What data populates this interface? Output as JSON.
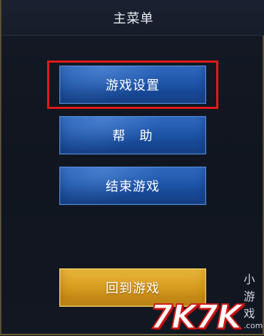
{
  "header": {
    "title": "主菜单"
  },
  "menu": {
    "items": [
      {
        "label": "游戏设置"
      },
      {
        "label": "帮　助"
      },
      {
        "label": "结束游戏"
      }
    ],
    "return_label": "回到游戏"
  },
  "watermark": {
    "logo": "7K7K",
    "subtitle": "小游戏",
    "url": ".com"
  },
  "colors": {
    "background": "#10151f",
    "button_blue": "#1f55a8",
    "button_gold": "#d89e22",
    "highlight": "#e01a1a",
    "frame_gold": "#8a7a44"
  }
}
